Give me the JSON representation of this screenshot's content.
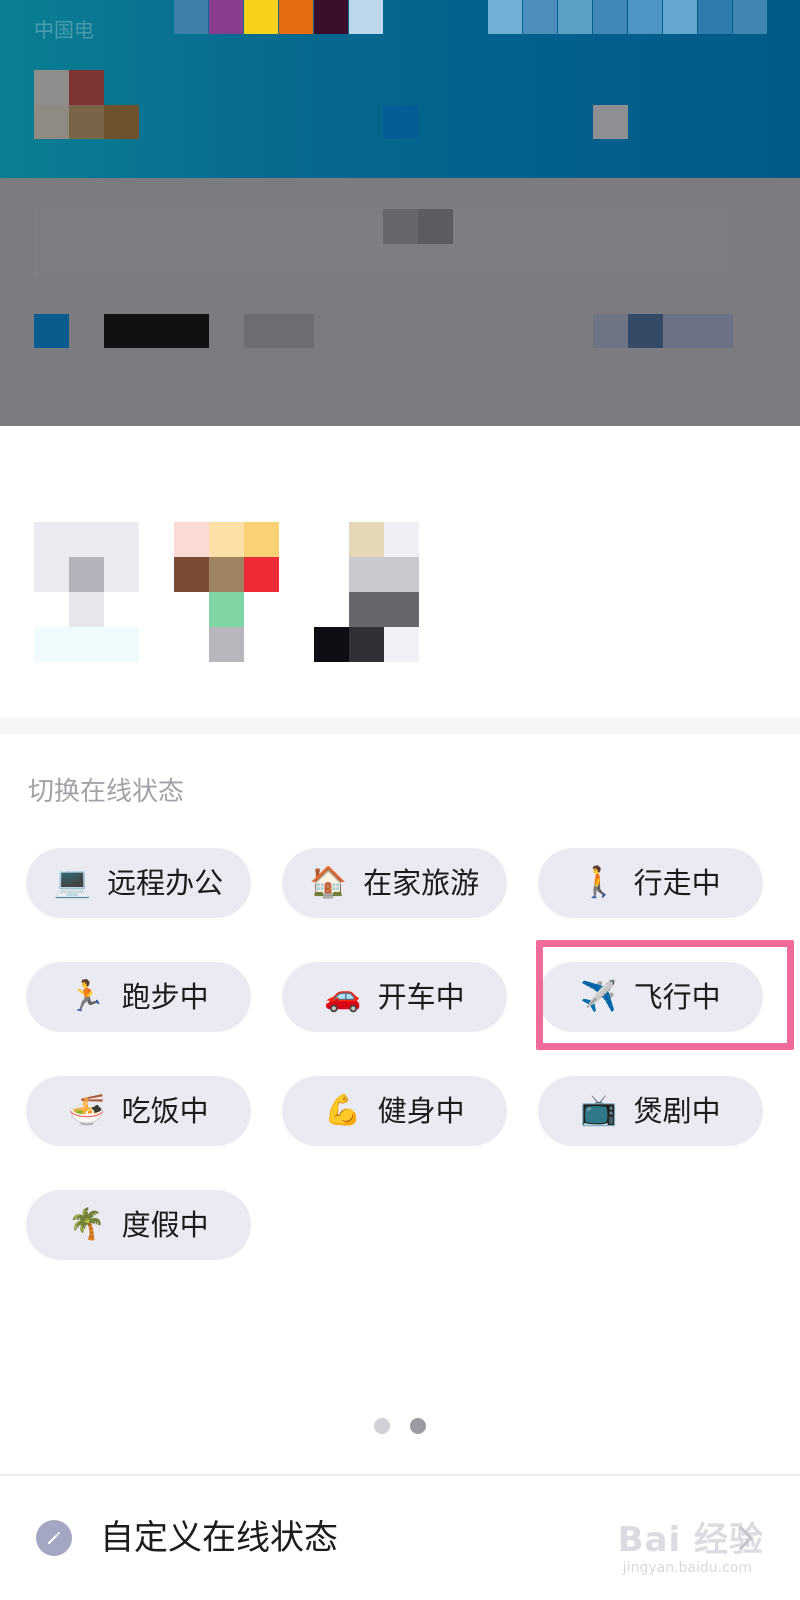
{
  "status_bar": {
    "carrier": "中国电"
  },
  "online_status": {
    "section_title": "切换在线状态",
    "options": [
      {
        "emoji": "💻",
        "label": "远程办公",
        "icon_name": "laptop-icon"
      },
      {
        "emoji": "🏠",
        "label": "在家旅游",
        "icon_name": "house-icon"
      },
      {
        "emoji": "🚶",
        "label": "行走中",
        "icon_name": "walking-person-icon"
      },
      {
        "emoji": "🏃",
        "label": "跑步中",
        "icon_name": "running-person-icon"
      },
      {
        "emoji": "🚗",
        "label": "开车中",
        "icon_name": "car-icon"
      },
      {
        "emoji": "✈️",
        "label": "飞行中",
        "icon_name": "airplane-icon",
        "highlighted": true
      },
      {
        "emoji": "🍜",
        "label": "吃饭中",
        "icon_name": "noodle-bowl-icon"
      },
      {
        "emoji": "💪",
        "label": "健身中",
        "icon_name": "flexed-biceps-icon"
      },
      {
        "emoji": "📺",
        "label": "煲剧中",
        "icon_name": "television-icon"
      },
      {
        "emoji": "🌴",
        "label": "度假中",
        "icon_name": "palm-tree-icon"
      }
    ],
    "highlight_color": "#f16b9a"
  },
  "pagination": {
    "pages": 2,
    "active_page": 2
  },
  "custom_status": {
    "label": "自定义在线状态",
    "icon": "pencil-icon",
    "chevron": "chevron-right-icon"
  },
  "watermark": {
    "text": "Bai 经验",
    "sub": "jingyan.baidu.com"
  },
  "colors": {
    "button_bg": "#eaebf2",
    "header_bg": "#035f8d",
    "overlay_gray": "#7b7b80"
  }
}
